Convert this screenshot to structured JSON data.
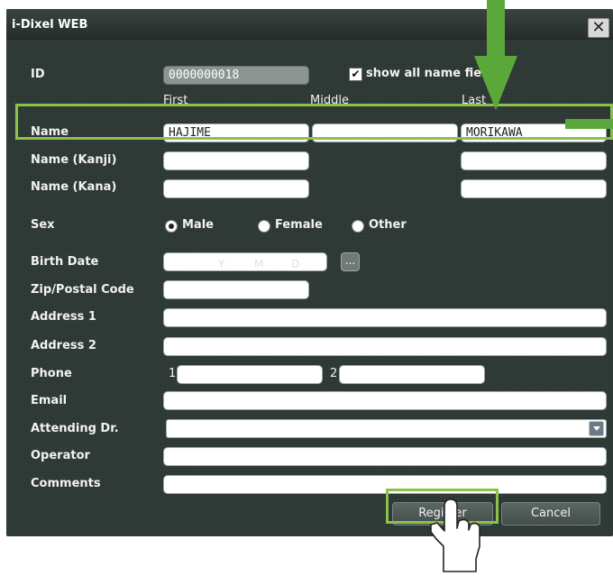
{
  "window": {
    "title": "i-Dixel WEB",
    "close_glyph": "✕"
  },
  "form": {
    "id_label": "ID",
    "id_value": "0000000018",
    "show_all_checkbox": {
      "checked_glyph": "✔",
      "label": "show all name fields"
    },
    "columns": {
      "first": "First",
      "middle": "Middle",
      "last": "Last"
    },
    "name_label": "Name",
    "name_first": "HAJIME",
    "name_middle": "",
    "name_last": "MORIKAWA",
    "name_kanji_label": "Name (Kanji)",
    "name_kana_label": "Name (Kana)",
    "sex_label": "Sex",
    "sex_options": [
      "Male",
      "Female",
      "Other"
    ],
    "sex_selected": "Male",
    "birth_date_label": "Birth Date",
    "birth_date_placeholders": {
      "y": "Y",
      "m": "M",
      "d": "D"
    },
    "birth_date_button": "...",
    "zip_label": "Zip/Postal Code",
    "address1_label": "Address 1",
    "address2_label": "Address 2",
    "phone_label": "Phone",
    "phone1_prefix": "1",
    "phone2_prefix": "2",
    "email_label": "Email",
    "attending_label": "Attending Dr.",
    "operator_label": "Operator",
    "comments_label": "Comments"
  },
  "buttons": {
    "register": "Register",
    "cancel": "Cancel"
  },
  "annotation_colors": {
    "highlight": "#8cc24b",
    "arrow": "#5aa83a"
  }
}
